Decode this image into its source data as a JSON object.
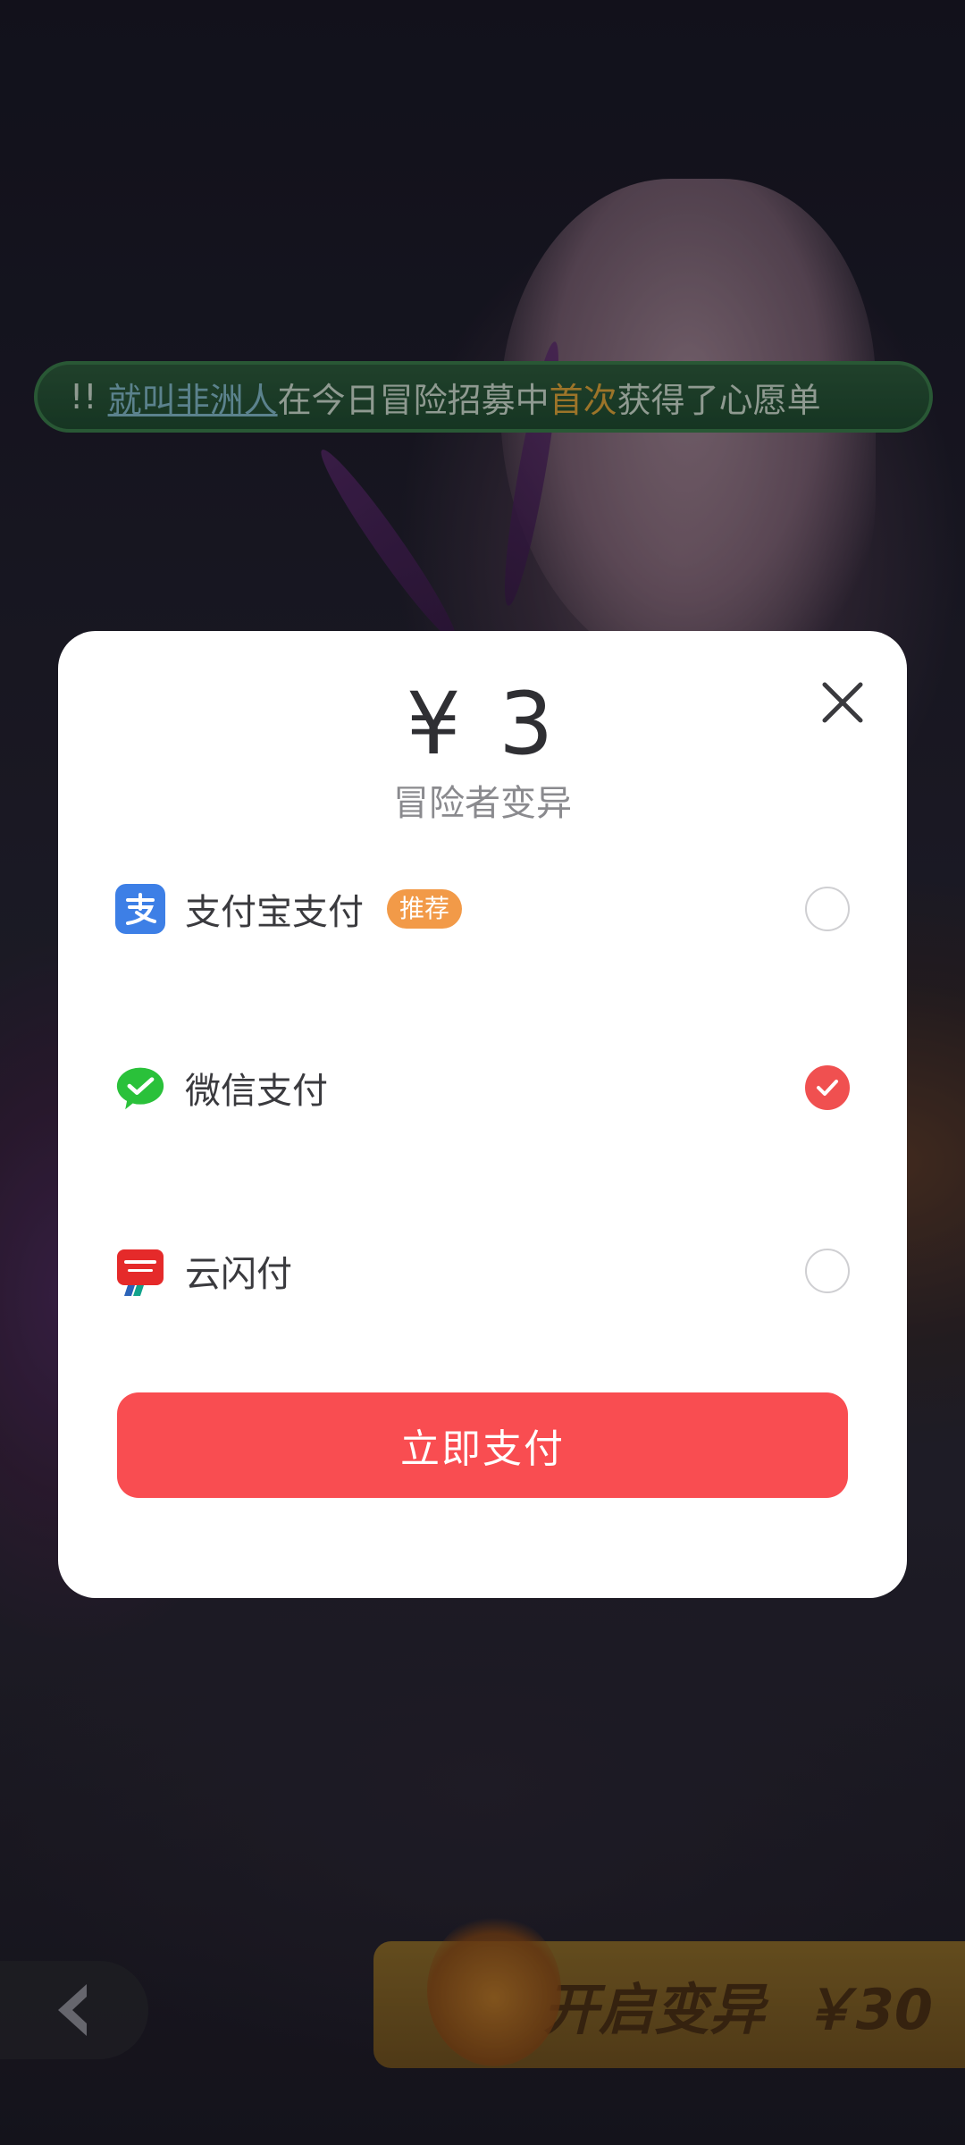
{
  "background": {
    "marquee": {
      "prefix": "!!",
      "player_name": "就叫非洲人",
      "text_before": "在今日冒险招募中",
      "highlight": "首次",
      "text_after": "获得了心愿单"
    },
    "back_icon": "chevron-left-icon",
    "mutate_button": {
      "label": "开启变异",
      "price": "￥30"
    }
  },
  "modal": {
    "price": "¥ 3",
    "product_name": "冒险者变异",
    "close_icon": "close-icon",
    "payment_methods": [
      {
        "label": "支付宝支付",
        "badge": "推荐",
        "icon": "alipay-icon",
        "selected": false
      },
      {
        "label": "微信支付",
        "badge": "",
        "icon": "wechat-pay-icon",
        "selected": true
      },
      {
        "label": "云闪付",
        "badge": "",
        "icon": "unionpay-quickpass-icon",
        "selected": false
      }
    ],
    "pay_button_label": "立即支付"
  },
  "colors": {
    "accent_red": "#f94d51",
    "badge_orange": "#f29a48",
    "alipay_blue": "#3d7fe6",
    "wechat_green": "#2ac13a",
    "union_red": "#e52a2a"
  }
}
